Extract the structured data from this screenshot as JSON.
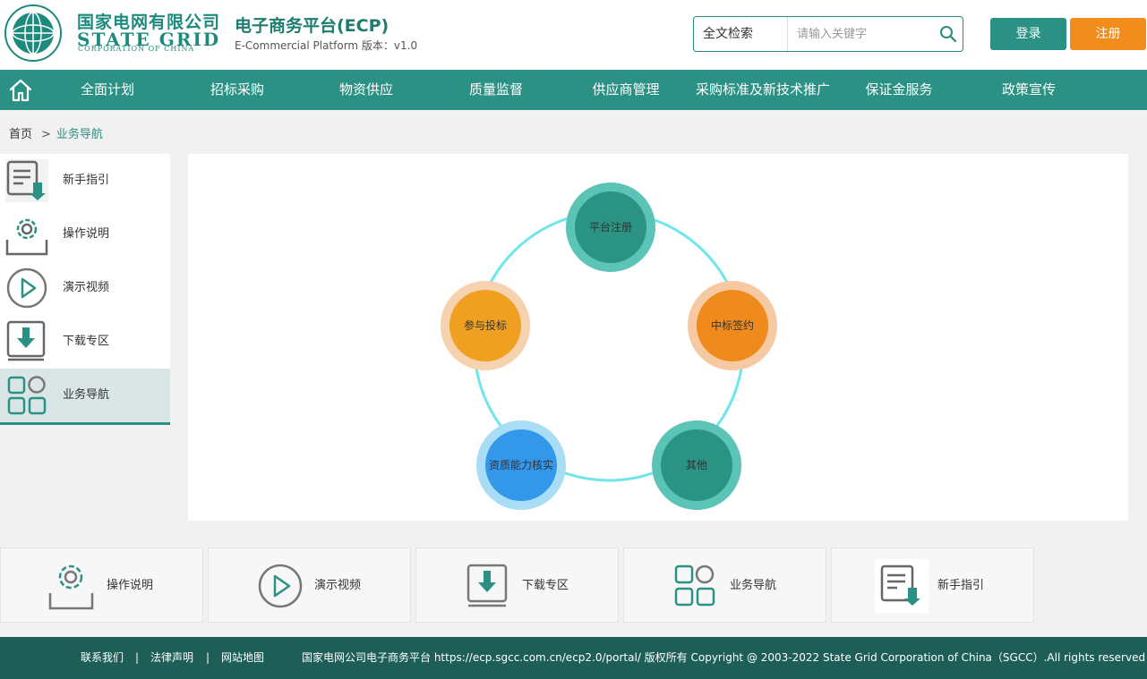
{
  "header": {
    "corp_cn": "国家电网有限公司",
    "corp_en": "STATE GRID",
    "corp_en2": "CORPORATION OF CHINA",
    "platform_title": "电子商务平台(ECP)",
    "platform_sub": "E-Commercial Platform 版本：v1.0",
    "search_type": "全文检索",
    "search_placeholder": "请输入关键字",
    "login_label": "登录",
    "register_label": "注册"
  },
  "nav": {
    "items": [
      "全面计划",
      "招标采购",
      "物资供应",
      "质量监督",
      "供应商管理",
      "采购标准及新技术推广",
      "保证金服务",
      "政策宣传"
    ]
  },
  "breadcrumb": {
    "home": "首页",
    "sep": ">",
    "current": "业务导航"
  },
  "sidebar": {
    "items": [
      {
        "label": "新手指引",
        "icon": "guide-icon"
      },
      {
        "label": "操作说明",
        "icon": "gear-icon"
      },
      {
        "label": "演示视频",
        "icon": "play-icon"
      },
      {
        "label": "下载专区",
        "icon": "download-icon"
      },
      {
        "label": "业务导航",
        "icon": "grid-icon",
        "active": true
      }
    ]
  },
  "diagram": {
    "nodes": [
      {
        "label": "平台注册",
        "color": "#2a9384",
        "ring": "#5cc3b7"
      },
      {
        "label": "中标签约",
        "color": "#ef8a1d",
        "ring": "#f6c9a2"
      },
      {
        "label": "其他",
        "color": "#2a9384",
        "ring": "#5cc3b7"
      },
      {
        "label": "资质能力核实",
        "color": "#3398ea",
        "ring": "#a9dcf5"
      },
      {
        "label": "参与投标",
        "color": "#f0a020",
        "ring": "#f6d2ae"
      }
    ],
    "circle_color": "#6ee6ec"
  },
  "cards": {
    "items": [
      {
        "label": "操作说明",
        "icon": "gear-icon"
      },
      {
        "label": "演示视频",
        "icon": "play-icon"
      },
      {
        "label": "下载专区",
        "icon": "download-icon"
      },
      {
        "label": "业务导航",
        "icon": "grid-icon"
      },
      {
        "label": "新手指引",
        "icon": "guide-icon"
      }
    ]
  },
  "footer": {
    "links": [
      "联系我们",
      "法律声明",
      "网站地图"
    ],
    "sep": "|",
    "copyright": "国家电网公司电子商务平台 https://ecp.sgcc.com.cn/ecp2.0/portal/ 版权所有 Copyright @ 2003-2022 State Grid Corporation of China（SGCC）.All rights reserved"
  },
  "colors": {
    "primary": "#2b9184",
    "accent": "#f28c1c",
    "footer": "#1d5e57"
  }
}
